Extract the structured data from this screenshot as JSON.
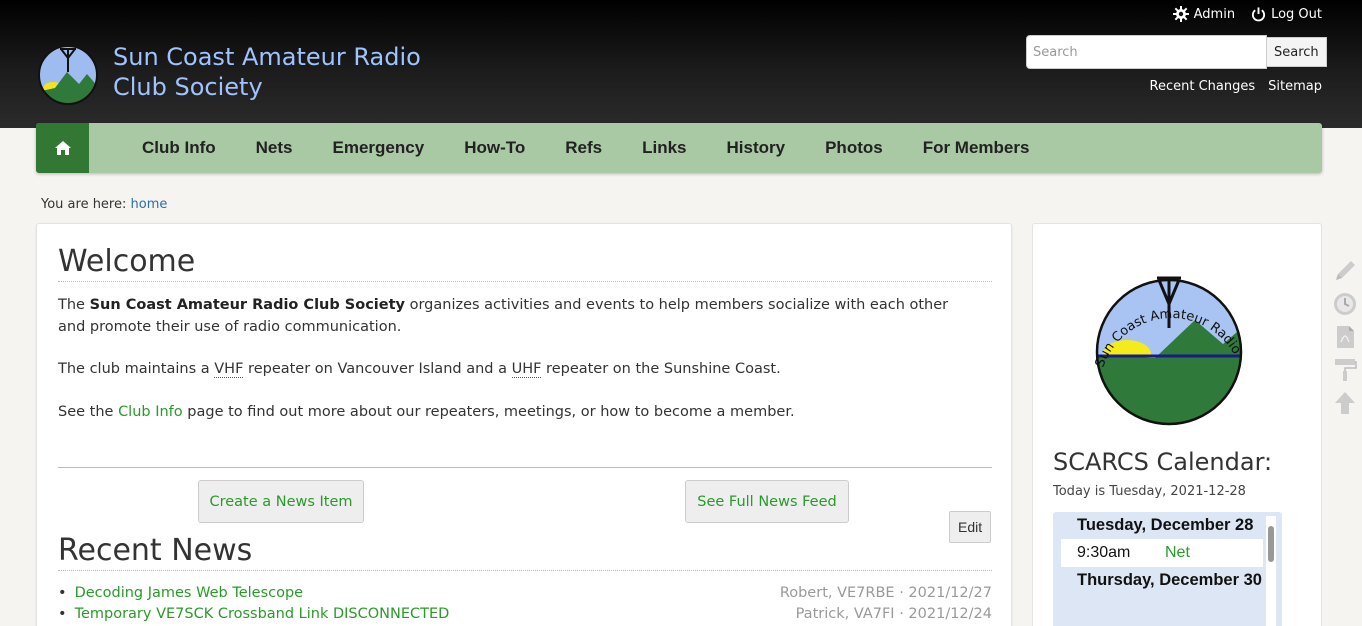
{
  "header": {
    "title": "Sun Coast Amateur Radio Club Society",
    "admin_label": "Admin",
    "logout_label": "Log Out",
    "search_placeholder": "Search",
    "search_button": "Search",
    "recent_changes": "Recent Changes",
    "sitemap": "Sitemap"
  },
  "nav": {
    "items": [
      "Club Info",
      "Nets",
      "Emergency",
      "How-To",
      "Refs",
      "Links",
      "History",
      "Photos",
      "For Members"
    ]
  },
  "breadcrumb": {
    "prefix": "You are here:",
    "home": "home"
  },
  "main": {
    "welcome_heading": "Welcome",
    "p1_pre": "The",
    "p1_bold": "Sun Coast Amateur Radio Club Society",
    "p1_post": "organizes activities and events to help members socialize with each other and promote their use of radio communication.",
    "p2_a": "The club maintains a",
    "p2_vhf": "VHF",
    "p2_b": "repeater on Vancouver Island and a",
    "p2_uhf": "UHF",
    "p2_c": "repeater on the Sunshine Coast.",
    "p3_a": "See the",
    "p3_link": "Club Info",
    "p3_b": "page to find out more about our repeaters, meetings, or how to become a member.",
    "create_news": "Create a News Item",
    "full_feed": "See Full News Feed",
    "edit": "Edit",
    "news_heading": "Recent News",
    "news": [
      {
        "title": "Decoding James Web Telescope",
        "meta": "Robert, VE7RBE · 2021/12/27"
      },
      {
        "title": "Temporary VE7SCK Crossband Link DISCONNECTED",
        "meta": "Patrick, VA7FI · 2021/12/24"
      }
    ]
  },
  "sidebar": {
    "seal_text": "Sun Coast Amateur Radio Club Society",
    "calendar_title": "SCARCS Calendar:",
    "today": "Today is Tuesday, 2021-12-28",
    "days": [
      {
        "day": "Tuesday, December 28",
        "time": "9:30am",
        "event": "Net"
      },
      {
        "day": "Thursday, December 30"
      }
    ]
  },
  "colors": {
    "header_bg": "#111111",
    "nav_bg": "#a9c9a4",
    "home_bg": "#327733",
    "link_green": "#2a9a2a",
    "title_blue": "#9ec3ff"
  },
  "icons": [
    "gear-icon",
    "power-icon",
    "home-icon",
    "pencil-icon",
    "clock-icon",
    "pdf-icon",
    "roller-icon",
    "arrow-up-icon"
  ]
}
